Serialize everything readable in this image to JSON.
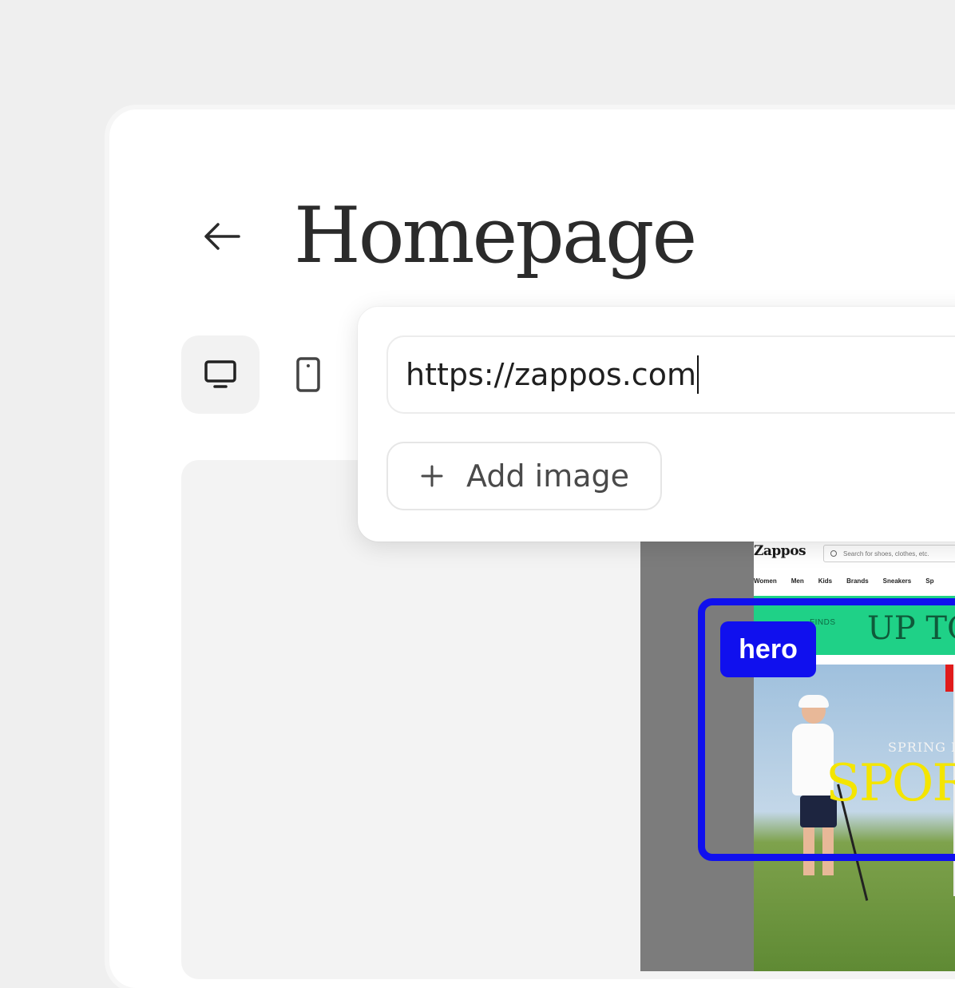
{
  "page": {
    "title": "Homepage",
    "back_icon": "arrow-left-icon"
  },
  "toolbar": {
    "desktop_icon": "monitor-icon",
    "mobile_icon": "smartphone-icon",
    "active_view": "desktop"
  },
  "url_popover": {
    "url_value": "https://zappos.com",
    "add_image_label": "Add image",
    "add_icon": "plus-icon"
  },
  "preview": {
    "logo": "Zappos",
    "search_placeholder": "Search for shoes, clothes, etc.",
    "nav": [
      "Women",
      "Men",
      "Kids",
      "Brands",
      "Sneakers",
      "Sp"
    ],
    "banner_small": "FINDS",
    "banner_big": "UP TO",
    "photo_pretitle": "SPRING I",
    "photo_headline": "SPOR",
    "section_label": "hero",
    "section_color": "#1010ee",
    "banner_color": "#1fd187",
    "headline_color": "#f4e500"
  }
}
